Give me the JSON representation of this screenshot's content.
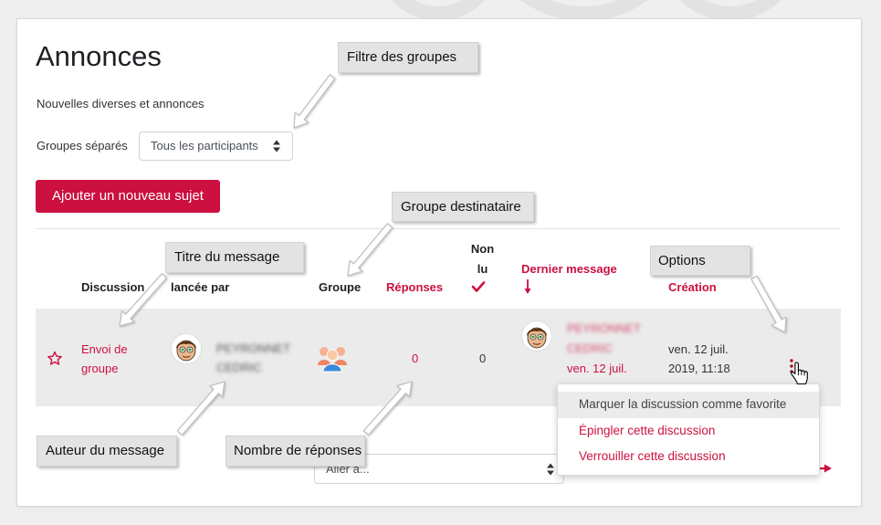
{
  "page": {
    "title": "Annonces",
    "description": "Nouvelles diverses et annonces"
  },
  "group_filter": {
    "label": "Groupes séparés",
    "selected": "Tous les participants"
  },
  "actions": {
    "add_topic": "Ajouter un nouveau sujet"
  },
  "table": {
    "headers": {
      "discussion": "Discussion",
      "started_by": "lancée par",
      "group": "Groupe",
      "replies": "Réponses",
      "unread": "Non lu",
      "last_post": "Dernier message",
      "created": "Création"
    },
    "rows": [
      {
        "title": "Envoi de groupe",
        "author": "PEYRONNET CEDRIC",
        "replies": "0",
        "unread": "0",
        "last_post_author": "PEYRONNET CEDRIC",
        "last_post_date": "ven. 12 juil.",
        "created": "ven. 12 juil. 2019, 11:18",
        "favourite": false
      }
    ]
  },
  "options_menu": {
    "items": [
      {
        "label": "Marquer la discussion comme favorite",
        "highlighted": true
      },
      {
        "label": "Épingler cette discussion",
        "highlighted": false
      },
      {
        "label": "Verrouiller cette discussion",
        "highlighted": false
      }
    ]
  },
  "jump_to": {
    "selected": "Aller à..."
  },
  "annotations": {
    "group_filter": "Filtre des groupes",
    "target_group": "Groupe destinataire",
    "message_title": "Titre du message",
    "options": "Options",
    "message_author": "Auteur du message",
    "reply_count": "Nombre de réponses"
  },
  "icons": {
    "favourite": "star-outline-icon",
    "sort": "arrow-down-icon",
    "unread": "check-icon",
    "select": "sort-arrows-icon",
    "group": "group-icon",
    "avatar": "user-avatar-icon",
    "options": "kebab-menu-icon",
    "cursor": "hand-pointer-icon",
    "next": "arrow-right-icon"
  },
  "colors": {
    "brand": "#cc1040",
    "row_background": "#ebebeb",
    "annotation_background": "#e3e3e3",
    "text": "#1d2125"
  }
}
